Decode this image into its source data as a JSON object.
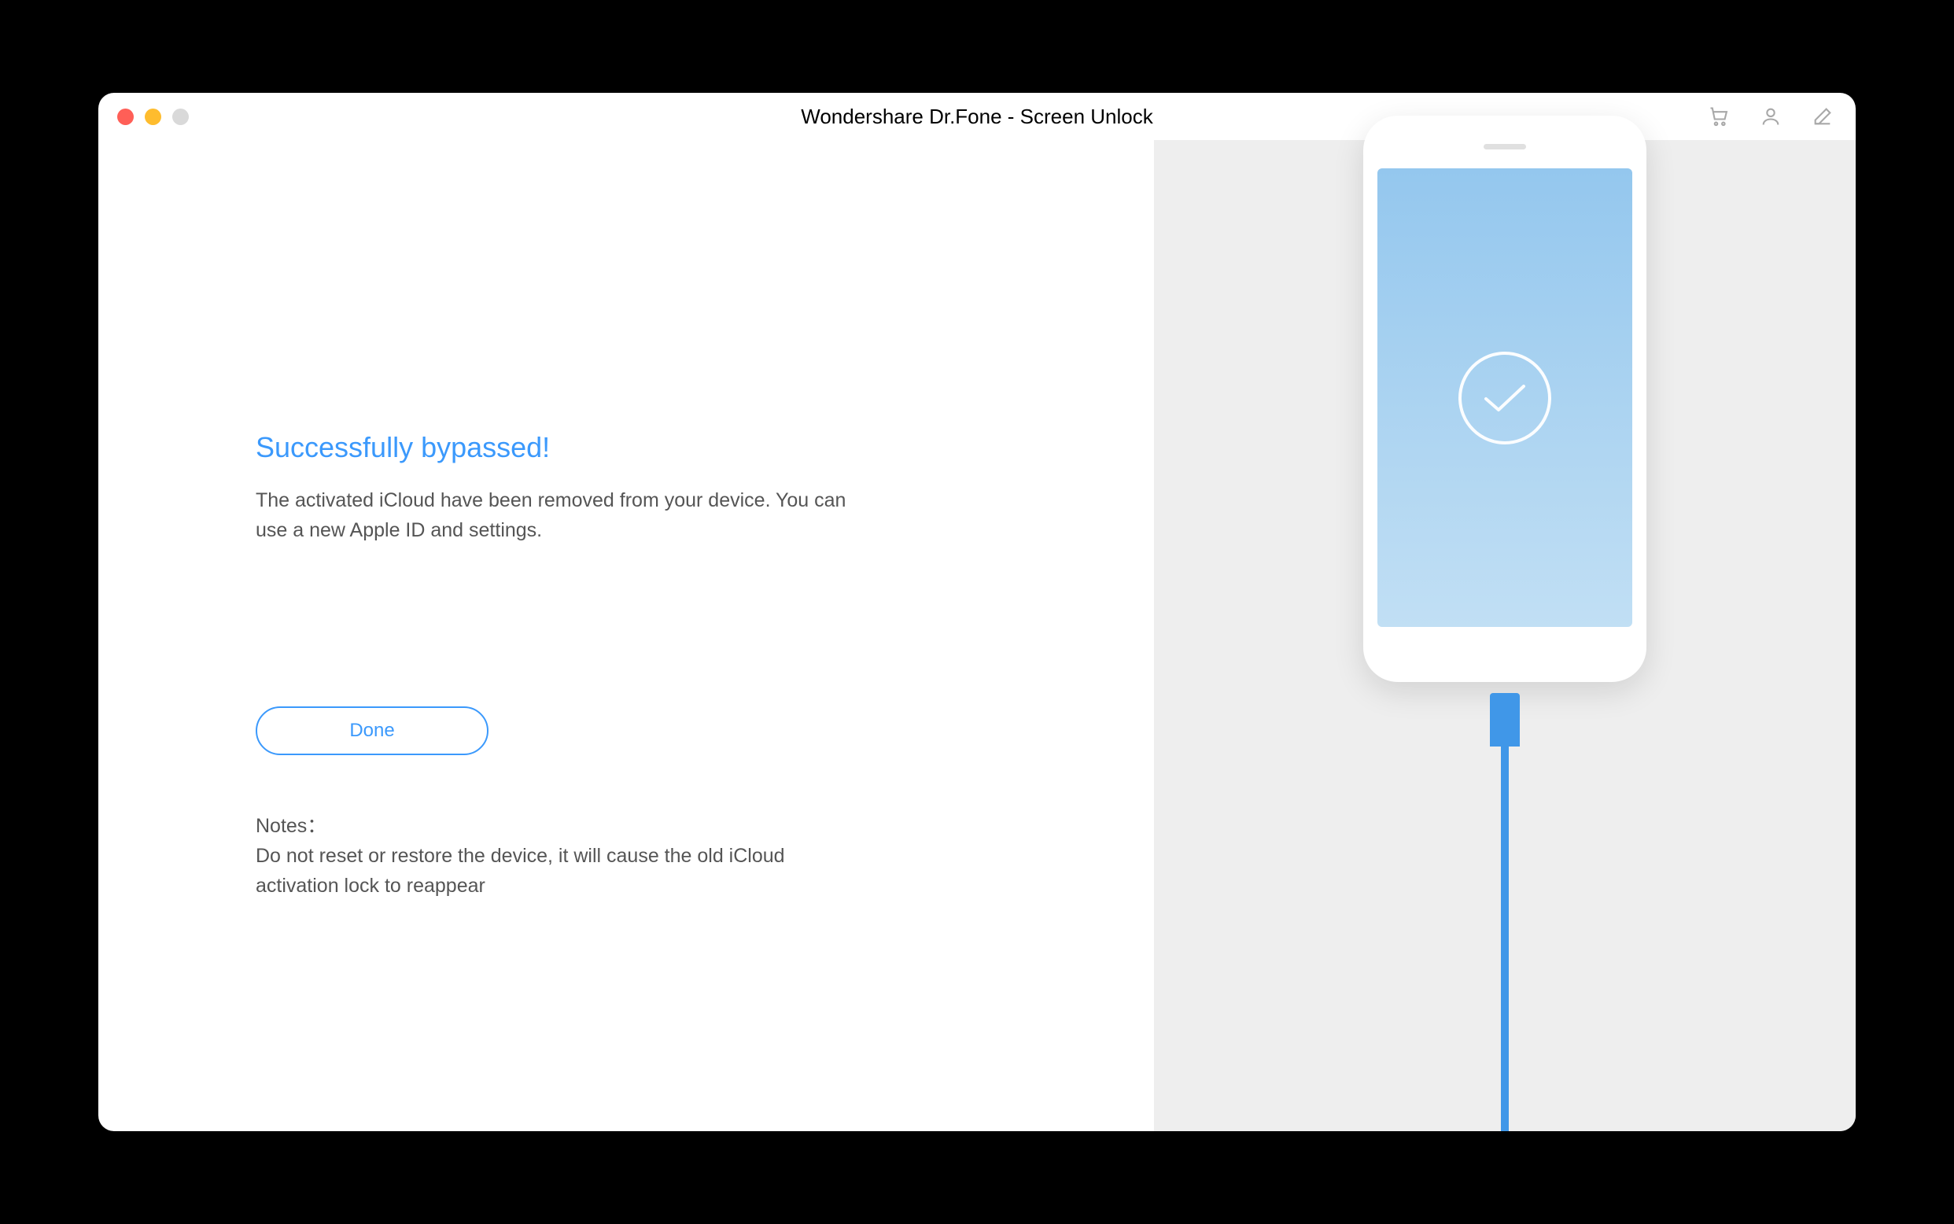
{
  "window": {
    "title": "Wondershare Dr.Fone - Screen Unlock"
  },
  "main": {
    "heading": "Successfully bypassed!",
    "description": "The activated iCloud have been removed from your device. You can use a new Apple ID and settings.",
    "done_label": "Done",
    "notes_label": "Notes：",
    "notes_text": "Do not reset or restore the device, it will cause the old iCloud activation lock to reappear"
  },
  "icons": {
    "cart": "cart-icon",
    "user": "user-icon",
    "edit": "edit-icon"
  }
}
